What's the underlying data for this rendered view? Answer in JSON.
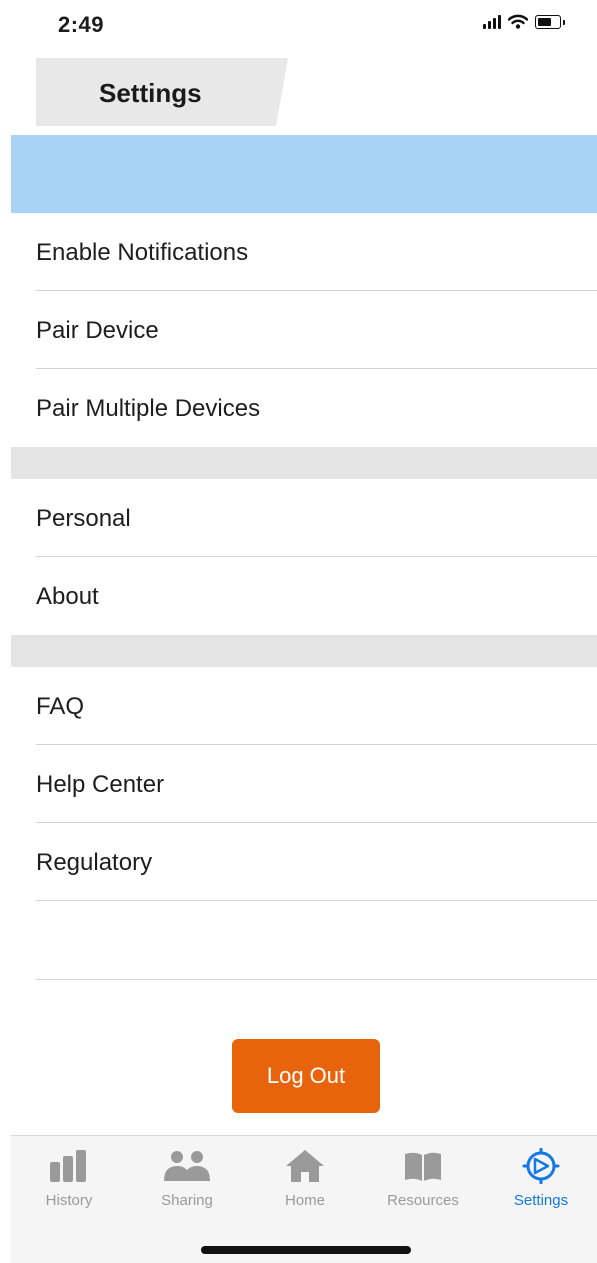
{
  "status_bar": {
    "time": "2:49"
  },
  "header": {
    "title": "Settings"
  },
  "sections": [
    {
      "items": [
        {
          "label": "Enable Notifications"
        },
        {
          "label": "Pair Device"
        },
        {
          "label": "Pair Multiple Devices"
        }
      ]
    },
    {
      "items": [
        {
          "label": "Personal"
        },
        {
          "label": "About"
        }
      ]
    },
    {
      "items": [
        {
          "label": "FAQ"
        },
        {
          "label": "Help Center"
        },
        {
          "label": "Regulatory"
        }
      ]
    }
  ],
  "logout": {
    "label": "Log Out"
  },
  "tab_bar": {
    "tabs": [
      {
        "label": "History",
        "icon": "bar-chart-icon"
      },
      {
        "label": "Sharing",
        "icon": "people-icon"
      },
      {
        "label": "Home",
        "icon": "house-icon"
      },
      {
        "label": "Resources",
        "icon": "book-icon"
      },
      {
        "label": "Settings",
        "icon": "settings-icon",
        "active": true
      }
    ]
  },
  "colors": {
    "banner": "#a9d3f6",
    "accent_orange": "#e8640c",
    "active_tab": "#1478e6",
    "inactive_tab": "#9a9a9a",
    "section_gap": "#e4e4e4"
  }
}
